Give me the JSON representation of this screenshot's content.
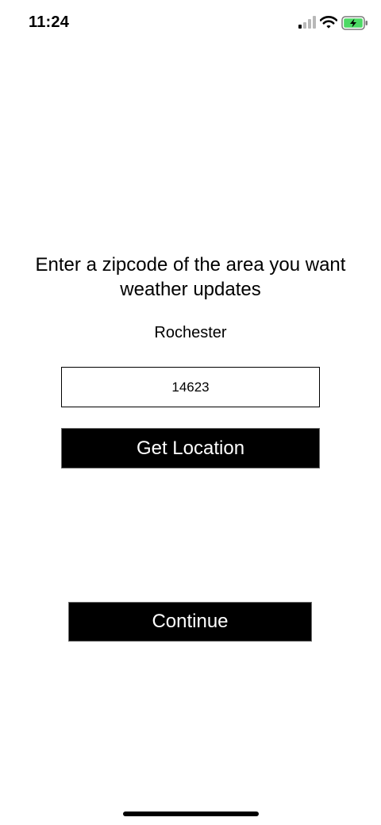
{
  "status_bar": {
    "time": "11:24",
    "icons": [
      "signal-icon",
      "wifi-icon",
      "battery-charging-icon"
    ],
    "battery_color": "#4cd964"
  },
  "main": {
    "prompt": "Enter a zipcode of the area you want weather updates",
    "city": "Rochester",
    "zip_value": "14623",
    "get_location_label": "Get Location",
    "continue_label": "Continue"
  }
}
